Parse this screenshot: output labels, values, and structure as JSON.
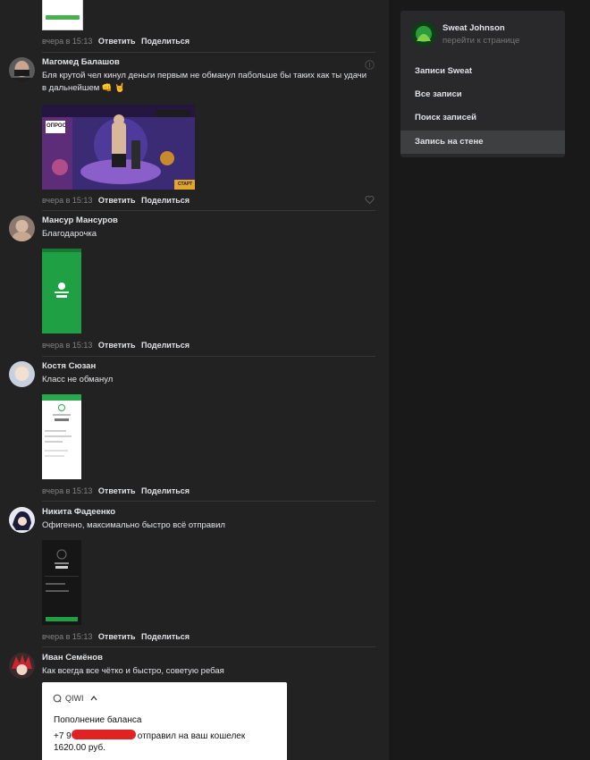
{
  "comments": [
    {
      "author": "",
      "text": "",
      "time": "вчера в 15:13",
      "reply": "Ответить",
      "share": "Поделиться"
    },
    {
      "author": "Магомед Балашов",
      "text": "Бля крутой чел кинул деньги первым не обманул пабольше бы таких как ты удачи в дальнейшем 👊 🤘",
      "time": "вчера в 15:13",
      "reply": "Ответить",
      "share": "Поделиться",
      "image_badges": [
        "ОПРОС",
        "СТАРТ"
      ]
    },
    {
      "author": "Мансур Мансуров",
      "text": "Благодарочка",
      "time": "вчера в 15:13",
      "reply": "Ответить",
      "share": "Поделиться"
    },
    {
      "author": "Костя Сюзан",
      "text": "Класс не обманул",
      "time": "вчера в 15:13",
      "reply": "Ответить",
      "share": "Поделиться"
    },
    {
      "author": "Никита Фадеенко",
      "text": "Офигенно, максимально быстро всё отправил",
      "time": "вчера в 15:13",
      "reply": "Ответить",
      "share": "Поделиться"
    },
    {
      "author": "Иван Семёнов",
      "text": "Как всегда все чётко и быстро, советую ребая",
      "qiwi": {
        "brand": "QIWI",
        "title": "Пополнение баланса",
        "line_prefix": "+7 9",
        "line_suffix": "отправил на ваш кошелек",
        "amount": "1620.00 руб."
      }
    }
  ],
  "sidebar": {
    "name": "Sweat Johnson",
    "link": "перейти к странице",
    "items": [
      {
        "label": "Записи Sweat"
      },
      {
        "label": "Все записи"
      },
      {
        "label": "Поиск записей"
      },
      {
        "label": "Запись на стене"
      }
    ],
    "active_index": 3
  },
  "colors": {
    "page_bg": "#19191a",
    "feed_bg": "#222223",
    "panel_bg": "#29292b",
    "active_item_bg": "#3e3f40",
    "text": "#e1e3e6",
    "muted": "#828282",
    "phone_green": "#1fa044"
  },
  "icons": [
    "kebab-icon",
    "like-icon",
    "chevron-down-icon",
    "qiwi-logo-icon"
  ]
}
